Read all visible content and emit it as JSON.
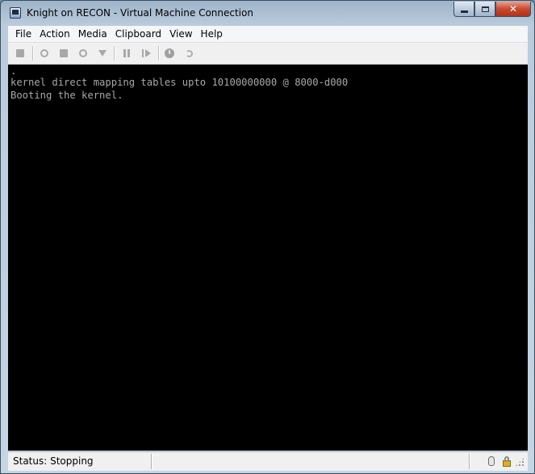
{
  "window": {
    "title": "Knight on RECON - Virtual Machine Connection",
    "controls": {
      "minimize_icon": "minimize-icon",
      "maximize_icon": "maximize-icon",
      "close_label": "✕"
    }
  },
  "menubar": {
    "items": [
      {
        "label": "File"
      },
      {
        "label": "Action"
      },
      {
        "label": "Media"
      },
      {
        "label": "Clipboard"
      },
      {
        "label": "View"
      },
      {
        "label": "Help"
      }
    ]
  },
  "toolbar": {
    "buttons": [
      {
        "icon": "ctrl-alt-del-icon"
      },
      {
        "icon": "start-icon"
      },
      {
        "icon": "turn-off-icon"
      },
      {
        "icon": "shutdown-icon"
      },
      {
        "icon": "save-state-icon"
      },
      {
        "icon": "pause-icon"
      },
      {
        "icon": "reset-icon"
      },
      {
        "icon": "snapshot-icon"
      },
      {
        "icon": "revert-icon"
      }
    ]
  },
  "console": {
    "lines": [
      ".",
      "kernel direct mapping tables upto 10100000000 @ 8000-d000",
      "Booting the kernel."
    ],
    "text_color": "#a8a8a8",
    "background": "#000000"
  },
  "statusbar": {
    "status": "Status: Stopping",
    "icons": [
      "mouse-icon",
      "lock-icon",
      "resize-grip-icon"
    ]
  }
}
